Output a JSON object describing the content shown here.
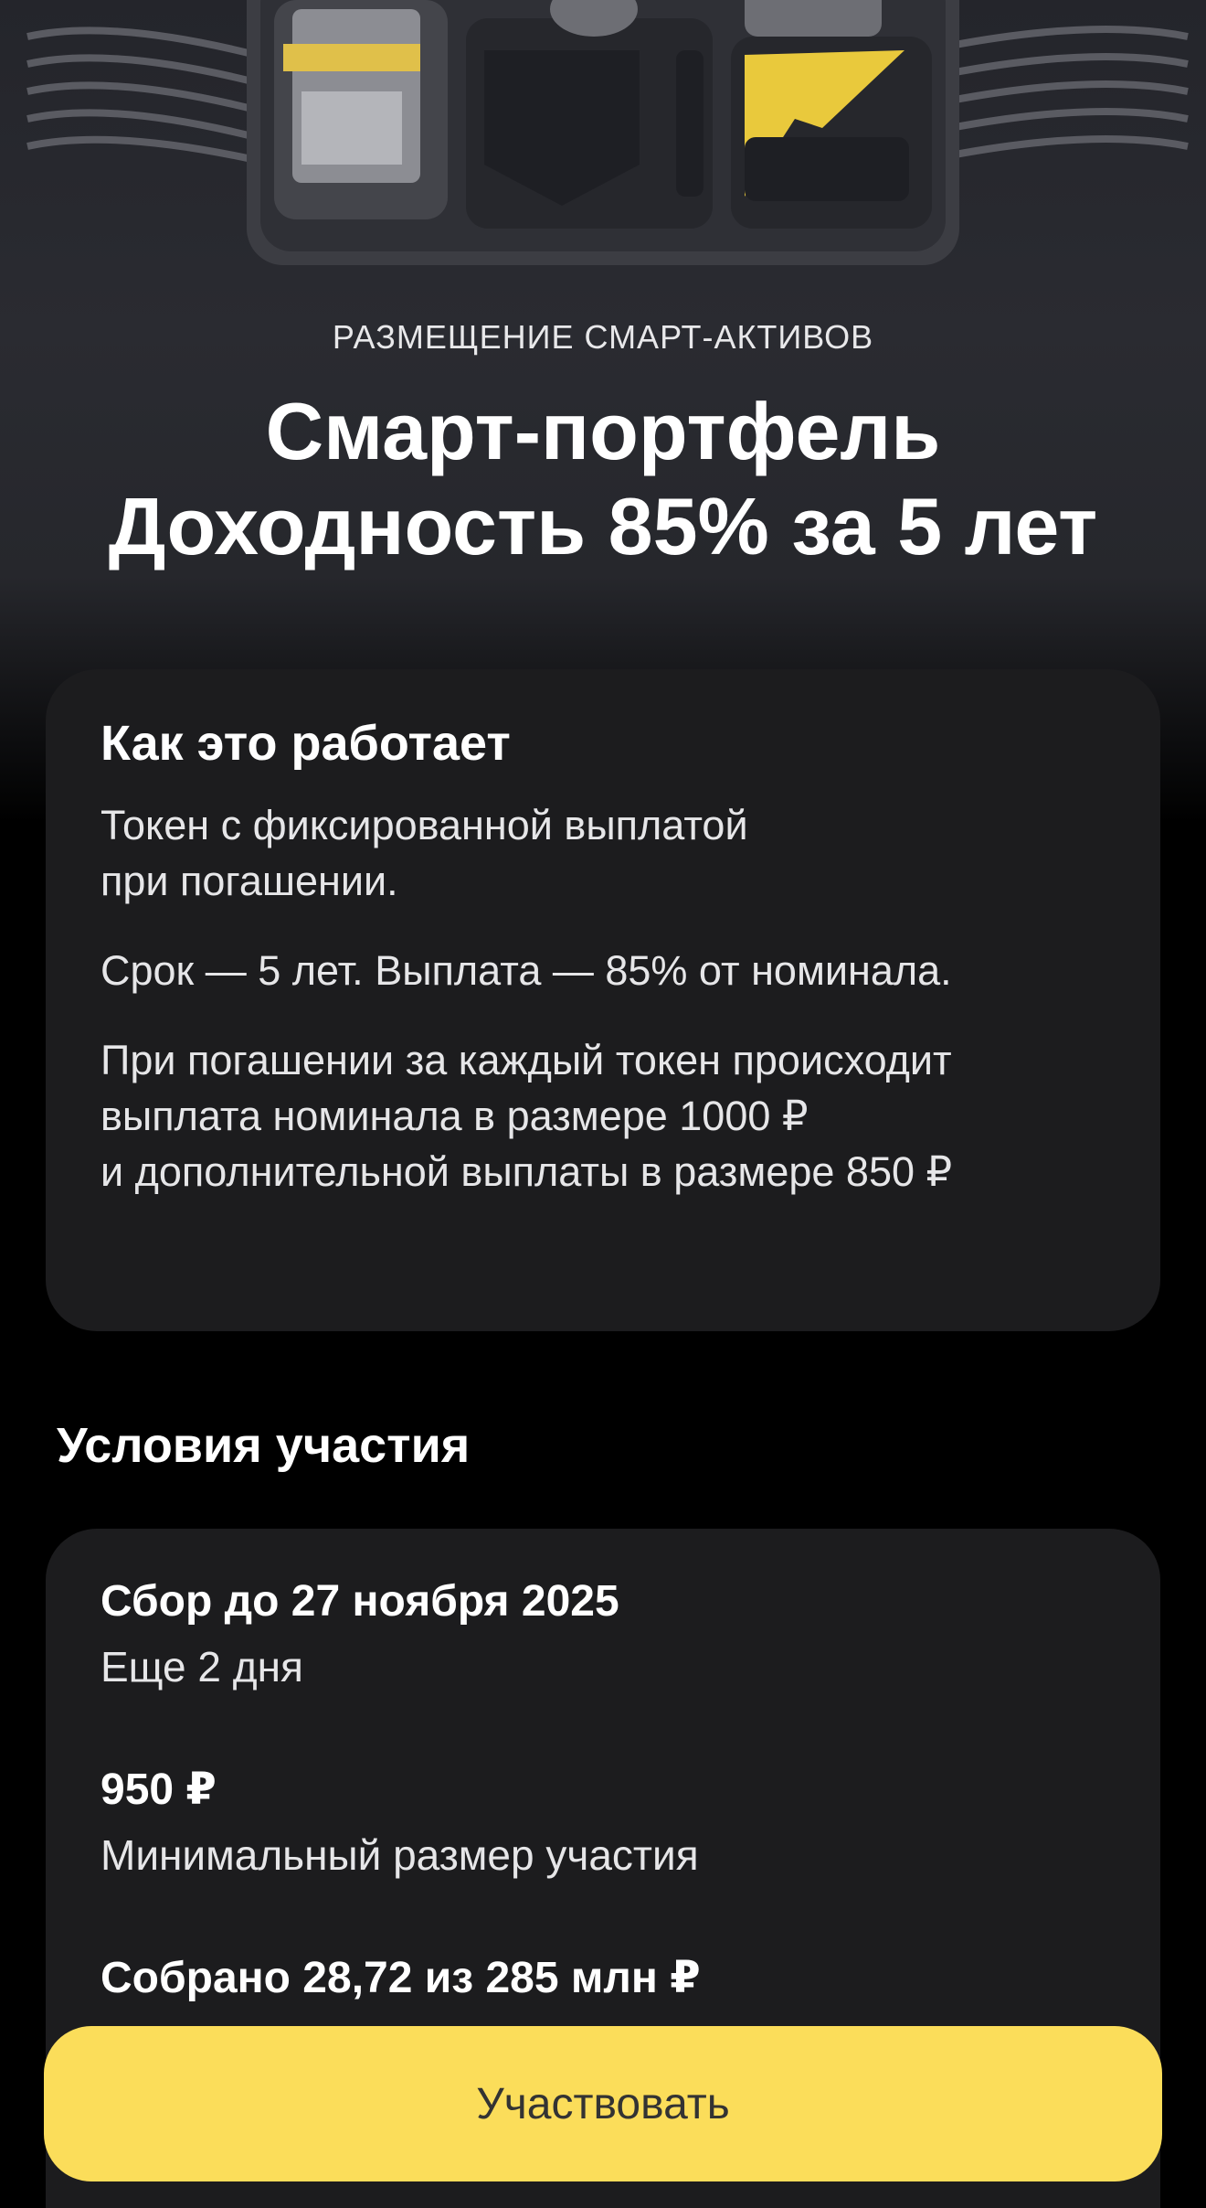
{
  "hero": {
    "eyebrow": "РАЗМЕЩЕНИЕ СМАРТ-АКТИВОВ",
    "title_line1": "Смарт-портфель",
    "title_line2": "Доходность 85% за 5 лет"
  },
  "how_it_works": {
    "title": "Как это работает",
    "paragraph1_line1": "Токен с фиксированной выплатой",
    "paragraph1_line2": "при погашении.",
    "paragraph2": "Срок — 5 лет. Выплата — 85% от номинала.",
    "paragraph3_line1": "При погашении за каждый токен происходит",
    "paragraph3_line2": "выплата номинала в размере 1000 ₽",
    "paragraph3_line3": "и дополнительной выплаты в размере 850 ₽"
  },
  "conditions": {
    "title": "Условия участия",
    "deadline": "Сбор до 27 ноября 2025",
    "deadline_sub": "Еще 2 дня",
    "min_amount": "950 ₽",
    "min_amount_sub": "Минимальный размер участия",
    "collected": "Собрано 28,72 из 285 млн ₽"
  },
  "cta": {
    "label": "Участвовать"
  },
  "colors": {
    "accent": "#fbdd5a",
    "card_bg": "#1c1c1e",
    "page_bg": "#000000"
  }
}
